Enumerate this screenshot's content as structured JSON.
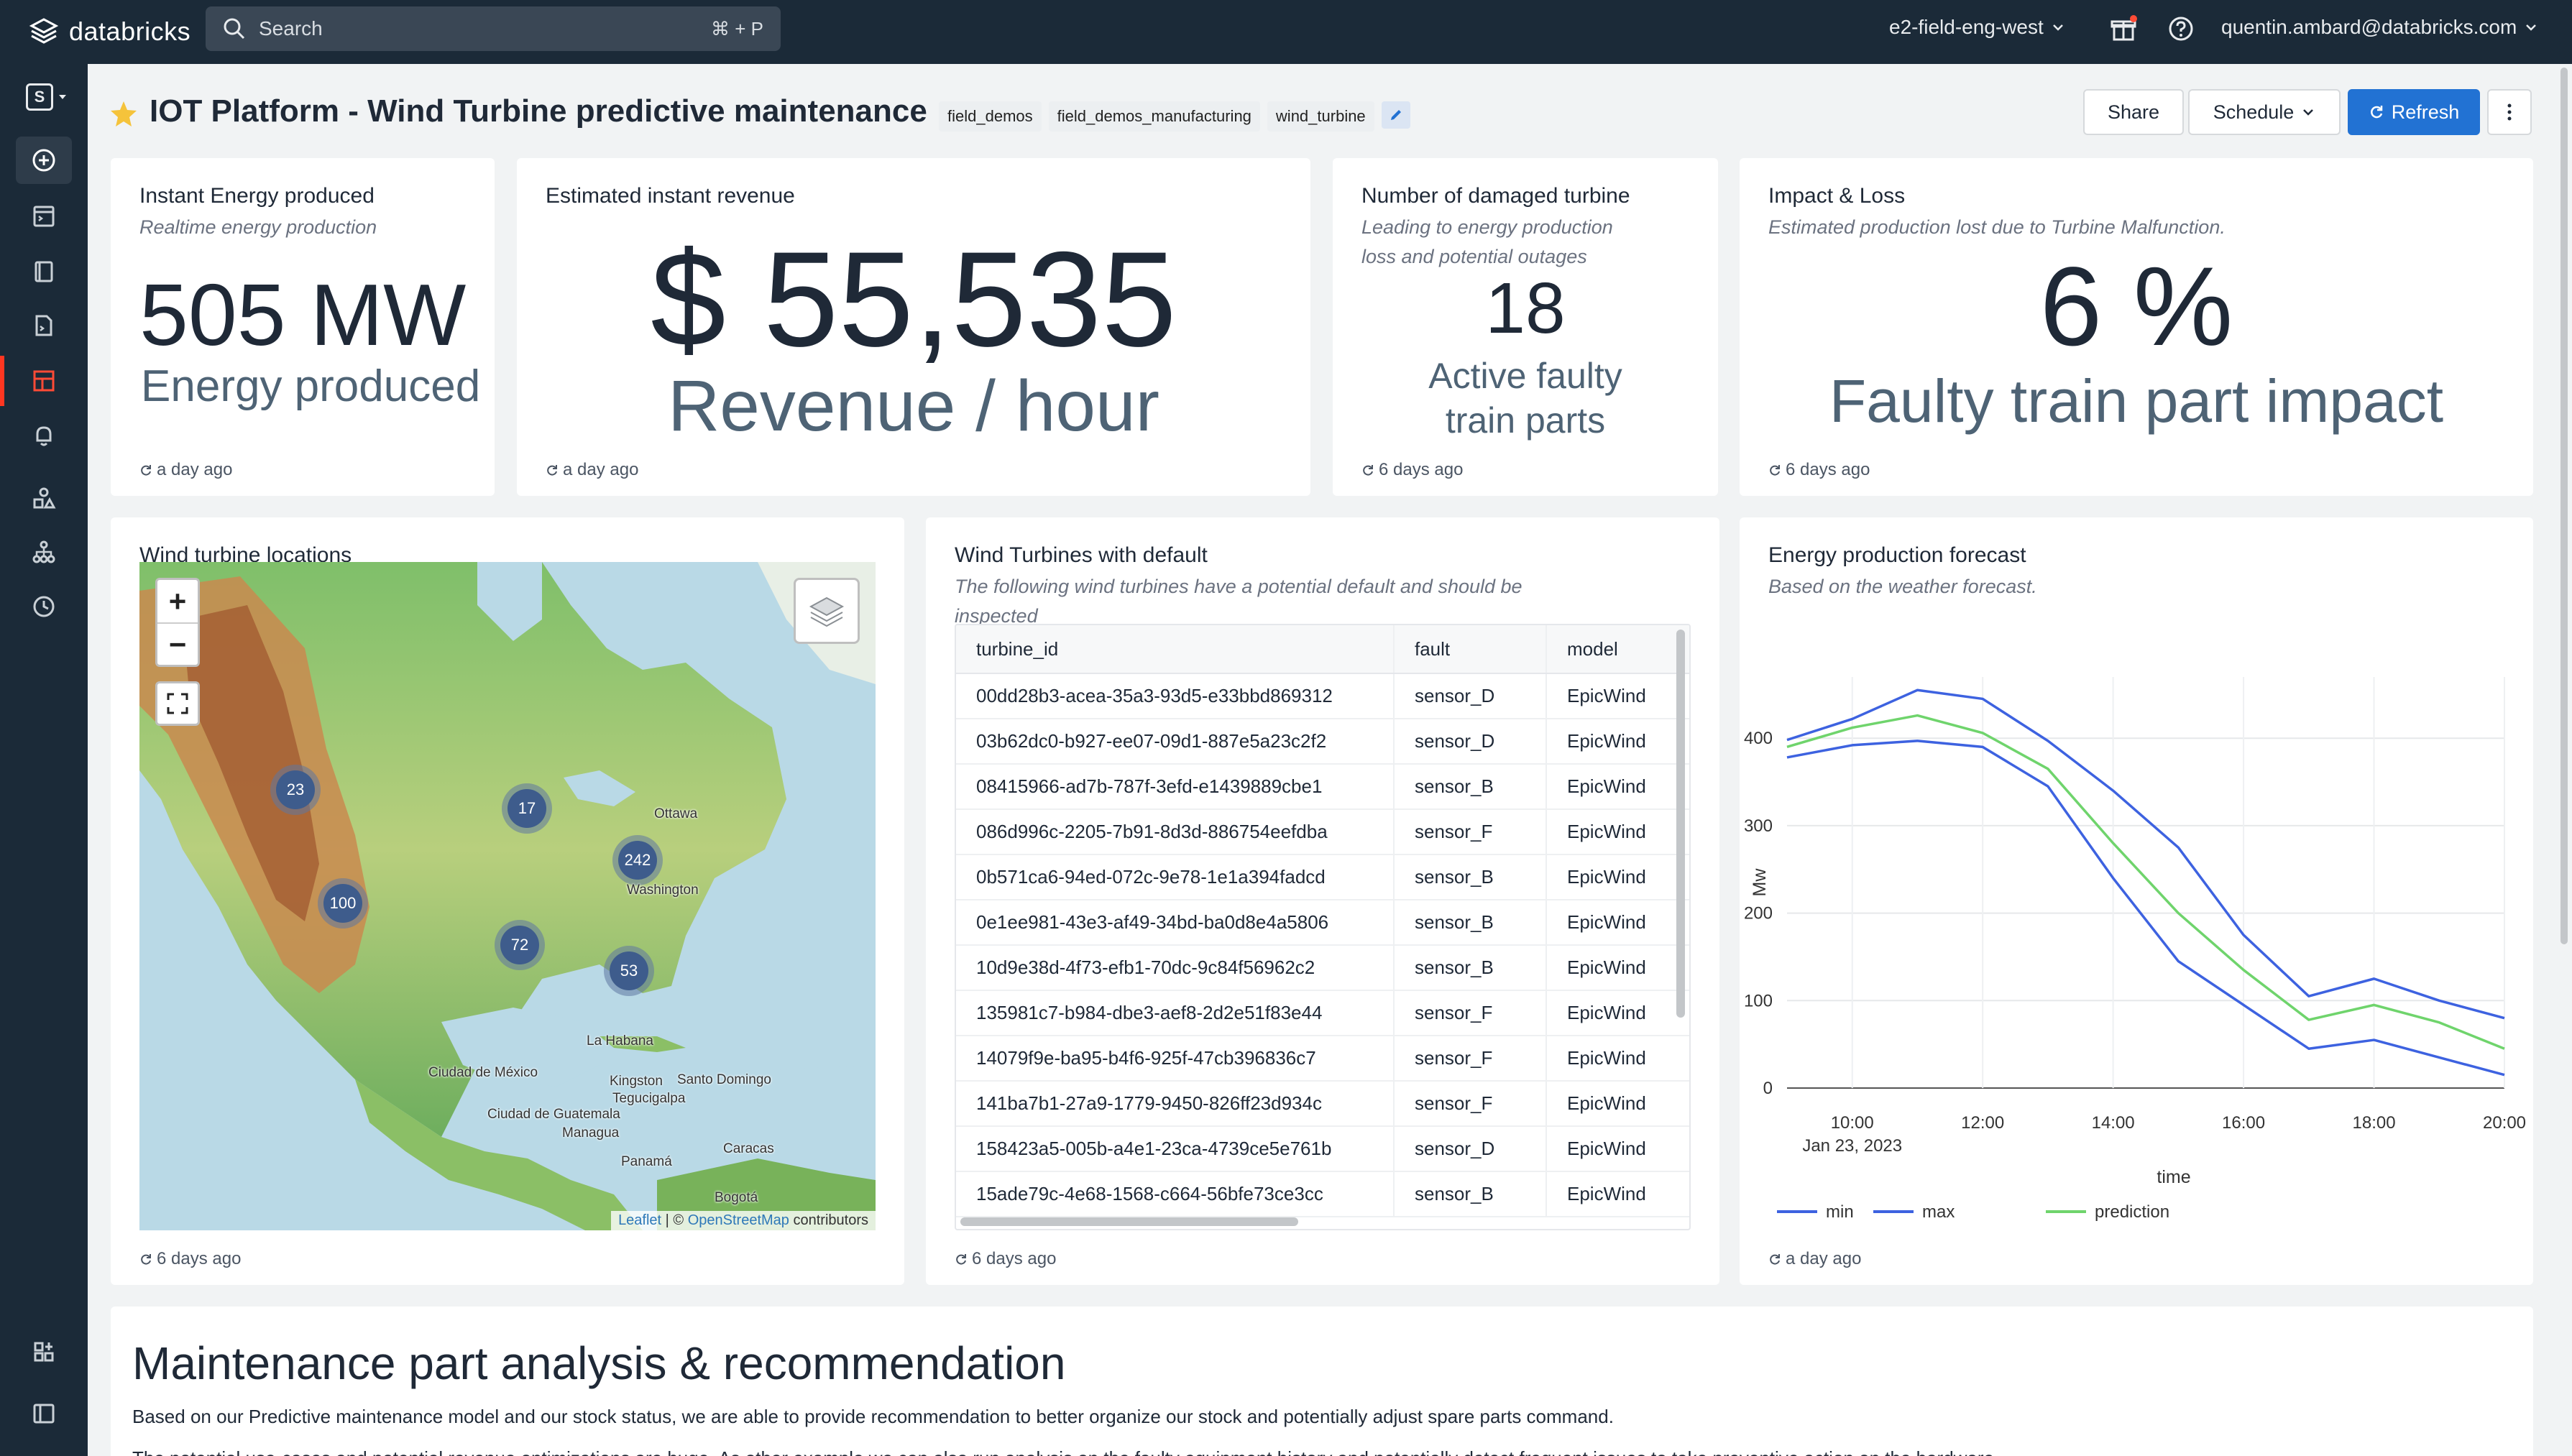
{
  "topbar": {
    "brand": "databricks",
    "search_label": "Search",
    "search_shortcut": "⌘ + P",
    "workspace": "e2-field-eng-west",
    "user": "quentin.ambard@databricks.com"
  },
  "rail": {
    "workspace_letter": "S",
    "items": [
      "new-icon",
      "sql-editor-icon",
      "queries-icon",
      "sql-file-icon",
      "dashboards-icon",
      "alerts-icon",
      "data-icon",
      "workflows-icon",
      "history-icon",
      "partner-connect-icon",
      "collapse-sidebar-icon"
    ]
  },
  "header": {
    "title": "IOT Platform - Wind Turbine predictive maintenance",
    "tags": [
      "field_demos",
      "field_demos_manufacturing",
      "wind_turbine"
    ],
    "share_label": "Share",
    "schedule_label": "Schedule",
    "refresh_label": "Refresh"
  },
  "kpis": {
    "energy": {
      "title": "Instant Energy produced",
      "subtitle": "Realtime energy production",
      "value": "505 MW",
      "unit": "Energy produced",
      "updated": "a day ago"
    },
    "revenue": {
      "title": "Estimated instant revenue",
      "value": "$ 55,535",
      "unit": "Revenue / hour",
      "updated": "a day ago"
    },
    "damaged": {
      "title": "Number of damaged turbine",
      "subtitle_line1": "Leading to energy production",
      "subtitle_line2": "loss and potential outages",
      "value": "18",
      "unit_line1": "Active faulty",
      "unit_line2": "train parts",
      "updated": "6 days ago"
    },
    "impact": {
      "title": "Impact & Loss",
      "subtitle": "Estimated production lost due to Turbine Malfunction.",
      "value": "6 %",
      "unit": "Faulty train part impact",
      "updated": "6 days ago"
    }
  },
  "map": {
    "title": "Wind turbine locations",
    "zoom_in": "+",
    "zoom_out": "−",
    "clusters": [
      "23",
      "17",
      "242",
      "100",
      "72",
      "53"
    ],
    "labels": [
      "Ottawa",
      "Washington",
      "La Habana",
      "Ciudad de México",
      "Kingston",
      "Santo Domingo",
      "Tegucigalpa",
      "Ciudad de Guatemala",
      "Managua",
      "Caracas",
      "Panamá",
      "Bogotá"
    ],
    "attribution_leaflet": "Leaflet",
    "attribution_sep": " | © ",
    "attribution_osm": "OpenStreetMap",
    "attribution_tail": " contributors",
    "updated": "6 days ago"
  },
  "faults": {
    "title": "Wind Turbines with default",
    "subtitle_line1": "The following wind turbines have a potential default and should be",
    "subtitle_line2": "inspected",
    "columns": [
      "turbine_id",
      "fault",
      "model"
    ],
    "rows": [
      [
        "00dd28b3-acea-35a3-93d5-e33bbd869312",
        "sensor_D",
        "EpicWind"
      ],
      [
        "03b62dc0-b927-ee07-09d1-887e5a23c2f2",
        "sensor_D",
        "EpicWind"
      ],
      [
        "08415966-ad7b-787f-3efd-e1439889cbe1",
        "sensor_B",
        "EpicWind"
      ],
      [
        "086d996c-2205-7b91-8d3d-886754eefdba",
        "sensor_F",
        "EpicWind"
      ],
      [
        "0b571ca6-94ed-072c-9e78-1e1a394fadcd",
        "sensor_B",
        "EpicWind"
      ],
      [
        "0e1ee981-43e3-af49-34bd-ba0d8e4a5806",
        "sensor_B",
        "EpicWind"
      ],
      [
        "10d9e38d-4f73-efb1-70dc-9c84f56962c2",
        "sensor_B",
        "EpicWind"
      ],
      [
        "135981c7-b984-dbe3-aef8-2d2e51f83e44",
        "sensor_F",
        "EpicWind"
      ],
      [
        "14079f9e-ba95-b4f6-925f-47cb396836c7",
        "sensor_F",
        "EpicWind"
      ],
      [
        "141ba7b1-27a9-1779-9450-826ff23d934c",
        "sensor_F",
        "EpicWind"
      ],
      [
        "158423a5-005b-a4e1-23ca-4739ce5e761b",
        "sensor_D",
        "EpicWind"
      ],
      [
        "15ade79c-4e68-1568-c664-56bfe73ce3cc",
        "sensor_B",
        "EpicWind"
      ]
    ],
    "updated": "6 days ago"
  },
  "forecast": {
    "title": "Energy production forecast",
    "subtitle": "Based on the weather forecast.",
    "updated": "a day ago"
  },
  "chart_data": {
    "type": "line",
    "title": "Energy production forecast",
    "xlabel": "time",
    "ylabel": "Mw",
    "x": [
      "09:00",
      "10:00",
      "11:00",
      "12:00",
      "13:00",
      "14:00",
      "15:00",
      "16:00",
      "17:00",
      "18:00",
      "19:00",
      "20:00"
    ],
    "x_tick_labels": [
      "10:00",
      "12:00",
      "14:00",
      "16:00",
      "18:00",
      "20:00"
    ],
    "x_date_label": "Jan 23, 2023",
    "y_ticks": [
      "0",
      "100",
      "200",
      "300",
      "400"
    ],
    "ylim": [
      0,
      470
    ],
    "grid": true,
    "legend_position": "bottom-left",
    "series": [
      {
        "name": "min",
        "color": "#3d62e0",
        "values": [
          378,
          392,
          397,
          390,
          345,
          240,
          145,
          95,
          45,
          55,
          35,
          15
        ]
      },
      {
        "name": "max",
        "color": "#3d62e0",
        "values": [
          398,
          422,
          455,
          445,
          397,
          340,
          275,
          175,
          105,
          125,
          100,
          80
        ]
      },
      {
        "name": "prediction",
        "color": "#6fd46c",
        "values": [
          390,
          412,
          426,
          406,
          365,
          280,
          200,
          135,
          78,
          95,
          75,
          45
        ]
      }
    ]
  },
  "analysis": {
    "title": "Maintenance part analysis & recommendation",
    "p1": "Based on our Predictive maintenance model and our stock status, we are able to provide recommendation to better organize our stock and potentially adjust spare parts command.",
    "p2": "The potential use-cases and potential revenue optimizations are huge. As other example we can also run analysis on the faulty equipment history and potentially detect frequent issues to take preventive action on the hardware."
  }
}
